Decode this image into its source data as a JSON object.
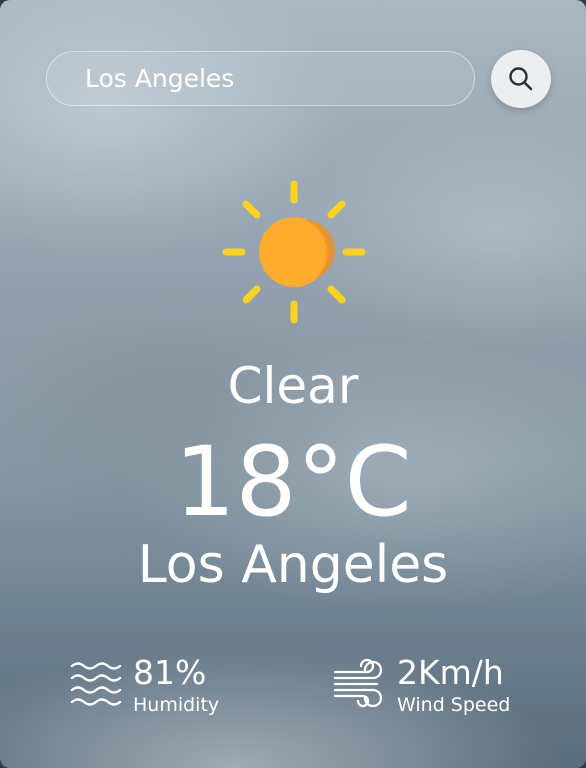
{
  "search": {
    "value": "Los Angeles",
    "icon": "search-icon"
  },
  "weather": {
    "icon": "sun-icon",
    "condition": "Clear",
    "temperature": "18°C",
    "city": "Los Angeles"
  },
  "details": {
    "humidity": {
      "value": "81%",
      "label": "Humidity",
      "icon": "humidity-waves-icon"
    },
    "wind": {
      "value": "2Km/h",
      "label": "Wind Speed",
      "icon": "wind-icon"
    }
  },
  "colors": {
    "sun": "#ffab2e",
    "sun_rays": "#ffd21f",
    "text": "#ffffff"
  }
}
